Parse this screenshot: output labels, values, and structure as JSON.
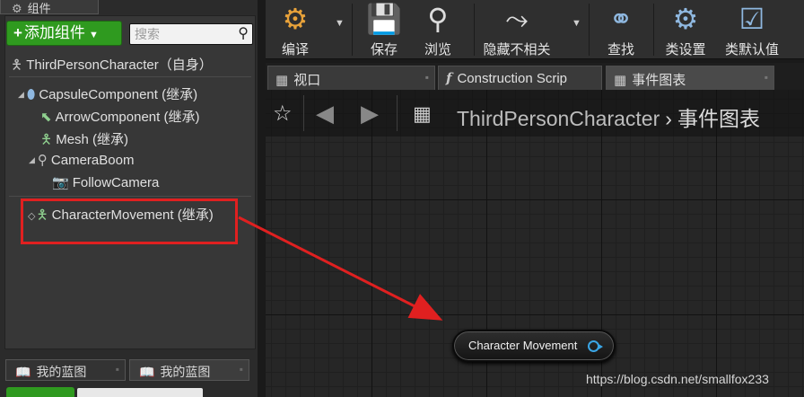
{
  "components_panel": {
    "tab_label": "组件",
    "add_button_label": "添加组件",
    "search_placeholder": "搜索",
    "root": "ThirdPersonCharacter（自身）",
    "tree": [
      {
        "label": "CapsuleComponent (继承)",
        "icon": "capsule-icon"
      },
      {
        "label": "ArrowComponent (继承)",
        "icon": "arrow-component-icon"
      },
      {
        "label": "Mesh (继承)",
        "icon": "mesh-icon"
      },
      {
        "label": "CameraBoom",
        "icon": "spring-arm-icon"
      },
      {
        "label": "FollowCamera",
        "icon": "camera-icon"
      }
    ],
    "movement_component": "CharacterMovement (继承)"
  },
  "my_blueprint_tabs": [
    "我的蓝图",
    "我的蓝图"
  ],
  "toolbar": {
    "compile": "编译",
    "save": "保存",
    "browse": "浏览",
    "hide_unrelated": "隐藏不相关",
    "find": "查找",
    "class_settings": "类设置",
    "class_defaults": "类默认值"
  },
  "doc_tabs": [
    {
      "label": "视口",
      "icon": "viewport-icon"
    },
    {
      "label": "Construction Scrip",
      "icon": "function-icon"
    },
    {
      "label": "事件图表",
      "icon": "event-graph-icon",
      "active": true
    }
  ],
  "graph": {
    "breadcrumb_root": "ThirdPersonCharacter",
    "breadcrumb_current": "事件图表",
    "node_label": "Character Movement",
    "pin_color": "#3aa6e6"
  },
  "annotation": {
    "color": "#e02020"
  },
  "watermark": "https://blog.csdn.net/smallfox233"
}
